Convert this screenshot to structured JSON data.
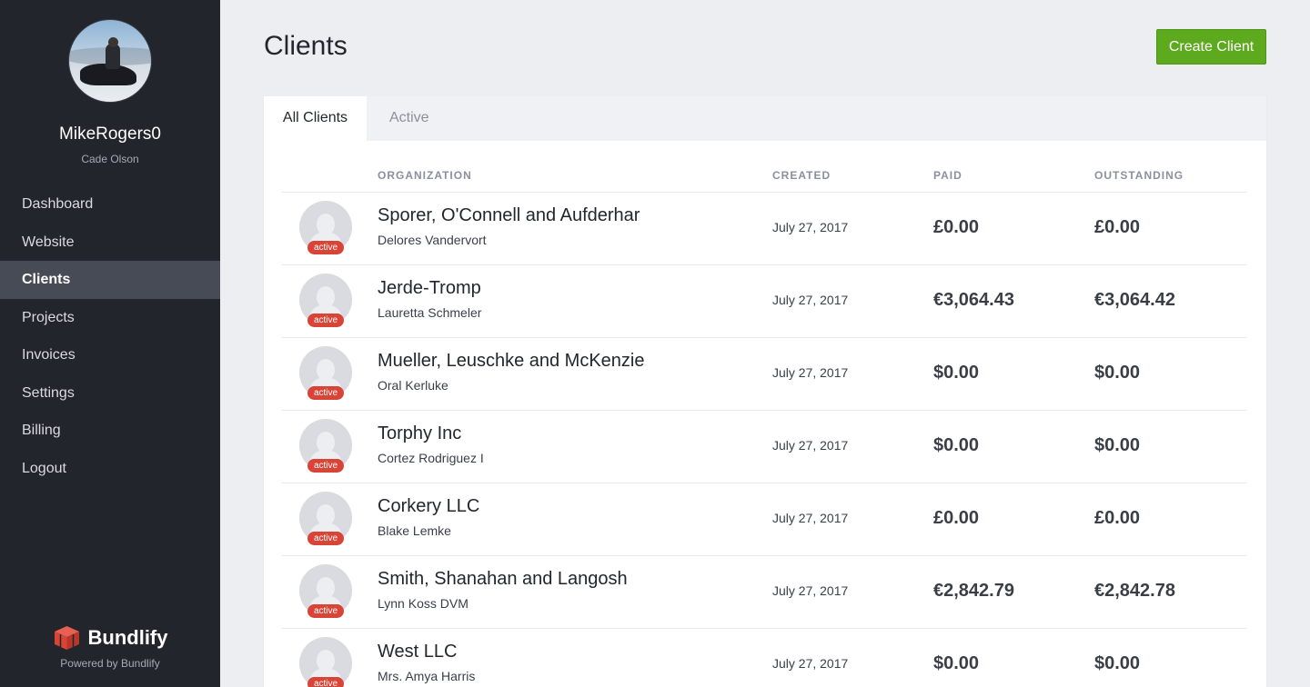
{
  "sidebar": {
    "username": "MikeRogers0",
    "subname": "Cade Olson",
    "nav": [
      "Dashboard",
      "Website",
      "Clients",
      "Projects",
      "Invoices",
      "Settings",
      "Billing",
      "Logout"
    ],
    "active_item": "Clients",
    "brand": "Bundlify",
    "powered_by": "Powered by Bundlify"
  },
  "page": {
    "title": "Clients",
    "create_button": "Create Client"
  },
  "tabs": [
    "All Clients",
    "Active"
  ],
  "table": {
    "columns": [
      "ORGANIZATION",
      "CREATED",
      "PAID",
      "OUTSTANDING"
    ],
    "rows": [
      {
        "status": "active",
        "organization": "Sporer, O'Connell and Aufderhar",
        "contact": "Delores Vandervort",
        "created": "July 27, 2017",
        "paid": "£0.00",
        "outstanding": "£0.00"
      },
      {
        "status": "active",
        "organization": "Jerde-Tromp",
        "contact": "Lauretta Schmeler",
        "created": "July 27, 2017",
        "paid": "€3,064.43",
        "outstanding": "€3,064.42"
      },
      {
        "status": "active",
        "organization": "Mueller, Leuschke and McKenzie",
        "contact": "Oral Kerluke",
        "created": "July 27, 2017",
        "paid": "$0.00",
        "outstanding": "$0.00"
      },
      {
        "status": "active",
        "organization": "Torphy Inc",
        "contact": "Cortez Rodriguez I",
        "created": "July 27, 2017",
        "paid": "$0.00",
        "outstanding": "$0.00"
      },
      {
        "status": "active",
        "organization": "Corkery LLC",
        "contact": "Blake Lemke",
        "created": "July 27, 2017",
        "paid": "£0.00",
        "outstanding": "£0.00"
      },
      {
        "status": "active",
        "organization": "Smith, Shanahan and Langosh",
        "contact": "Lynn Koss DVM",
        "created": "July 27, 2017",
        "paid": "€2,842.79",
        "outstanding": "€2,842.78"
      },
      {
        "status": "active",
        "organization": "West LLC",
        "contact": "Mrs. Amya Harris",
        "created": "July 27, 2017",
        "paid": "$0.00",
        "outstanding": "$0.00"
      }
    ]
  },
  "colors": {
    "sidebar_bg": "#22252c",
    "sidebar_active": "#474b56",
    "primary_button": "#5daa1e",
    "badge": "#d84436",
    "brand_logo": "#d84436"
  }
}
